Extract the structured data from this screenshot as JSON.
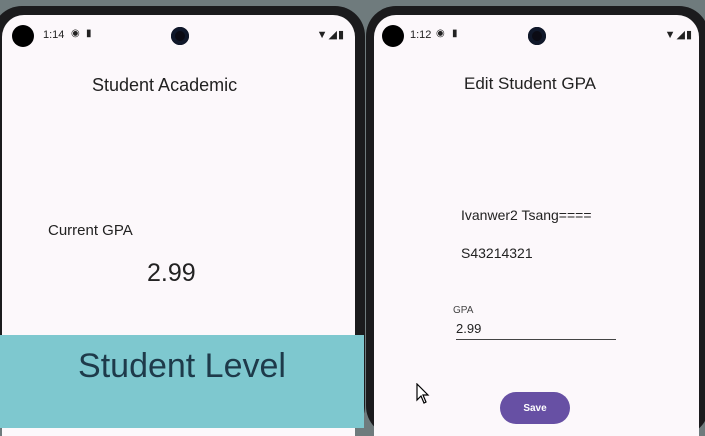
{
  "left_screen": {
    "status": {
      "time": "1:14",
      "icons": [
        "circle-notification-icon",
        "sim-card-icon"
      ],
      "system_icons": [
        "wifi-icon",
        "signal-icon",
        "battery-icon"
      ]
    },
    "title": "Student Academic",
    "gpa_label": "Current GPA",
    "gpa_value": "2.99"
  },
  "right_screen": {
    "status": {
      "time": "1:12",
      "icons": [
        "circle-notification-icon",
        "sim-card-icon"
      ],
      "system_icons": [
        "wifi-icon",
        "signal-icon",
        "battery-icon"
      ]
    },
    "title": "Edit Student GPA",
    "student_name": "Ivanwer2 Tsang====",
    "student_id": "S43214321",
    "gpa_field": {
      "label": "GPA",
      "value": "2.99"
    },
    "save_label": "Save"
  },
  "banner": {
    "text": "Student Level"
  },
  "colors": {
    "accent": "#6750a4",
    "banner": "#7ec8cf",
    "banner_text": "#1e3a4a",
    "screen_bg": "#fcf8fb"
  },
  "glyphs": {
    "notif": "◉",
    "sim": "▮",
    "sys": "▼◢▮"
  }
}
